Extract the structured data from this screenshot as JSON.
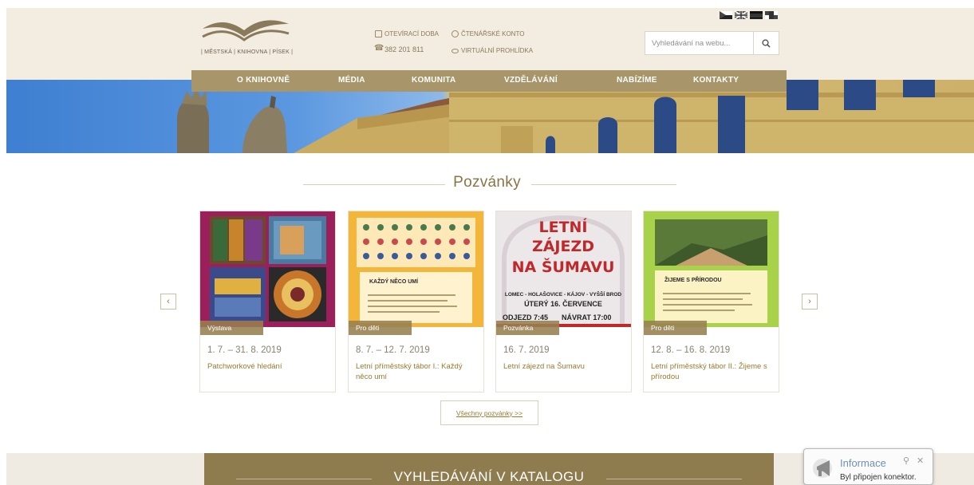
{
  "header": {
    "logo_text": "| MĚSTSKÁ | KNIHOVNA | PÍSEK |",
    "links": [
      {
        "label": "OTEVÍRACÍ DOBA",
        "icon": "calendar-icon"
      },
      {
        "label": "ČTENÁŘSKÉ KONTO",
        "icon": "user-icon"
      },
      {
        "label": "382 201 811",
        "icon": "phone-icon"
      },
      {
        "label": "VIRTUÁLNÍ PROHLÍDKA",
        "icon": "eye-icon"
      }
    ],
    "search": {
      "placeholder": "Vyhledávání na webu..."
    },
    "flags": [
      "flag-czech-icon",
      "flag-uk-icon",
      "flag-germany-icon",
      "flag-other-icon"
    ]
  },
  "nav": {
    "items": [
      "O KNIHOVNĚ",
      "MÉDIA",
      "KOMUNITA",
      "VZDĚLÁVÁNÍ",
      "NABÍZÍME",
      "KONTAKTY"
    ]
  },
  "section": {
    "title": "Pozvánky"
  },
  "cards": [
    {
      "tag": "Výstava",
      "date": "1. 7. – 31. 8. 2019",
      "title": "Patchworkové hledání"
    },
    {
      "tag": "Pro děti",
      "date": "8. 7. – 12. 7. 2019",
      "title": "Letní příměstský tábor I.: Každý něco umí",
      "poster_heading": "KAŽDÝ NĚCO UMÍ"
    },
    {
      "tag": "Pozvánka",
      "date": "16. 7. 2019",
      "title": "Letní zájezd na Šumavu",
      "poster_lines": [
        "LETNÍ",
        "ZÁJEZD",
        "NA ŠUMAVU"
      ],
      "poster_route": "LOMEC - HOLAŠOVICE - KÁJOV - VYŠŠÍ BROD",
      "poster_day": "ÚTERÝ 16. ČERVENCE",
      "poster_departure": "ODJEZD 7:45",
      "poster_return": "NÁVRAT 17:00"
    },
    {
      "tag": "Pro děti",
      "date": "12. 8. – 16. 8. 2019",
      "title": "Letní příměstský tábor II.: Žijeme s přírodou",
      "poster_heading": "ŽIJEME S PŘÍRODOU"
    }
  ],
  "all_button": "Všechny pozvánky >>",
  "catalog": {
    "title": "VYHLEDÁVÁNÍ V KATALOGU"
  },
  "notification": {
    "title": "Informace",
    "text": "Byl připojen konektor."
  },
  "colors": {
    "accent": "#a8956a",
    "header_bg": "#f3ece0",
    "catalog_bg": "#8f7c4e",
    "link": "#9a7a2c"
  }
}
